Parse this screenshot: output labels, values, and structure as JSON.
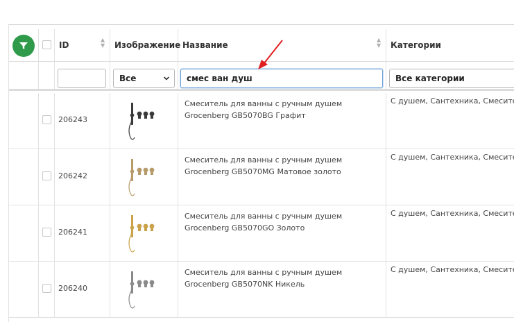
{
  "colors": {
    "filter_button": "#2e9a4a",
    "focus_border": "#6aa0d8",
    "annotation_arrow": "#e02020",
    "grid_line": "#e2e2e2",
    "faucet_graphite": "#3a3a3a",
    "faucet_matte_gold": "#b79a6a",
    "faucet_gold": "#c9a24a",
    "faucet_nickel": "#8a8a8a"
  },
  "header": {
    "filter_icon": "funnel-icon",
    "id": "ID",
    "image": "Изображение",
    "name": "Название",
    "categories": "Категории"
  },
  "filters": {
    "id_value": "",
    "image_select": "Все",
    "name_value": "смес ван душ",
    "categories_select": "Все категории"
  },
  "rows": [
    {
      "id": "206243",
      "name_line1": "Смеситель для ванны с ручным душем",
      "name_line2": "Grocenberg GB5070BG Графит",
      "categories": "С душем, Сантехника, Смесите",
      "finish_color": "faucet_graphite"
    },
    {
      "id": "206242",
      "name_line1": "Смеситель для ванны с ручным душем",
      "name_line2": "Grocenberg GB5070MG Матовое золото",
      "categories": "С душем, Сантехника, Смесите",
      "finish_color": "faucet_matte_gold"
    },
    {
      "id": "206241",
      "name_line1": "Смеситель для ванны с ручным душем",
      "name_line2": "Grocenberg GB5070GO Золото",
      "categories": "С душем, Сантехника, Смесите",
      "finish_color": "faucet_gold"
    },
    {
      "id": "206240",
      "name_line1": "Смеситель для ванны с ручным душем",
      "name_line2": "Grocenberg GB5070NK Никель",
      "categories": "С душем, Сантехника, Смесите",
      "finish_color": "faucet_nickel"
    }
  ]
}
